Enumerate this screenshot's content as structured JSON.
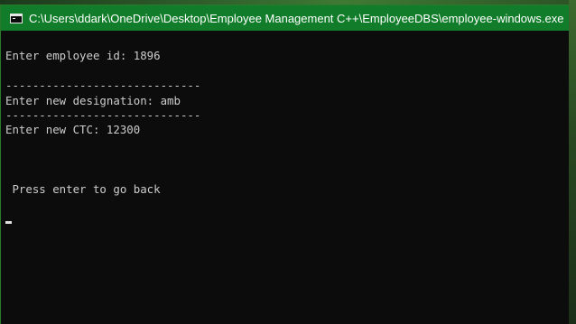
{
  "window": {
    "title": "C:\\Users\\ddark\\OneDrive\\Desktop\\Employee Management C++\\EmployeeDBS\\employee-windows.exe"
  },
  "console": {
    "lines": [
      "Enter employee id: 1896",
      "-----------------------------",
      "Enter new designation: amb",
      "-----------------------------",
      "Enter new CTC: 12300",
      " Press enter to go back"
    ]
  },
  "colors": {
    "titlebar": "#117d2a",
    "console_bg": "#0c0c0c",
    "console_text": "#cccccc"
  },
  "icons": {
    "app": "console-window-icon"
  }
}
